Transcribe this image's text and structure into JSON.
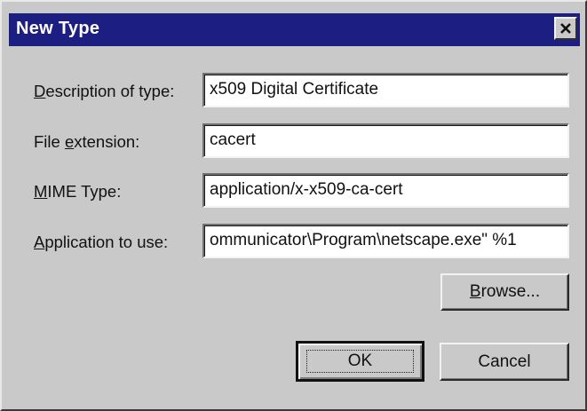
{
  "window": {
    "title": "New Type",
    "close_icon": "close-icon"
  },
  "fields": [
    {
      "label_ul": "D",
      "label_rest": "escription of type:",
      "value": "x509 Digital Certificate"
    },
    {
      "label_pre": "File ",
      "label_ul": "e",
      "label_rest": "xtension:",
      "value": "cacert"
    },
    {
      "label_ul": "M",
      "label_rest": "IME Type:",
      "value": "application/x-x509-ca-cert"
    },
    {
      "label_ul": "A",
      "label_rest": "pplication to use:",
      "value": "ommunicator\\Program\\netscape.exe\" %1"
    }
  ],
  "buttons": {
    "browse_ul": "B",
    "browse_rest": "rowse...",
    "ok": "OK",
    "cancel": "Cancel"
  },
  "colors": {
    "titlebar": "#1d1e82",
    "face": "#c9c9c9"
  }
}
